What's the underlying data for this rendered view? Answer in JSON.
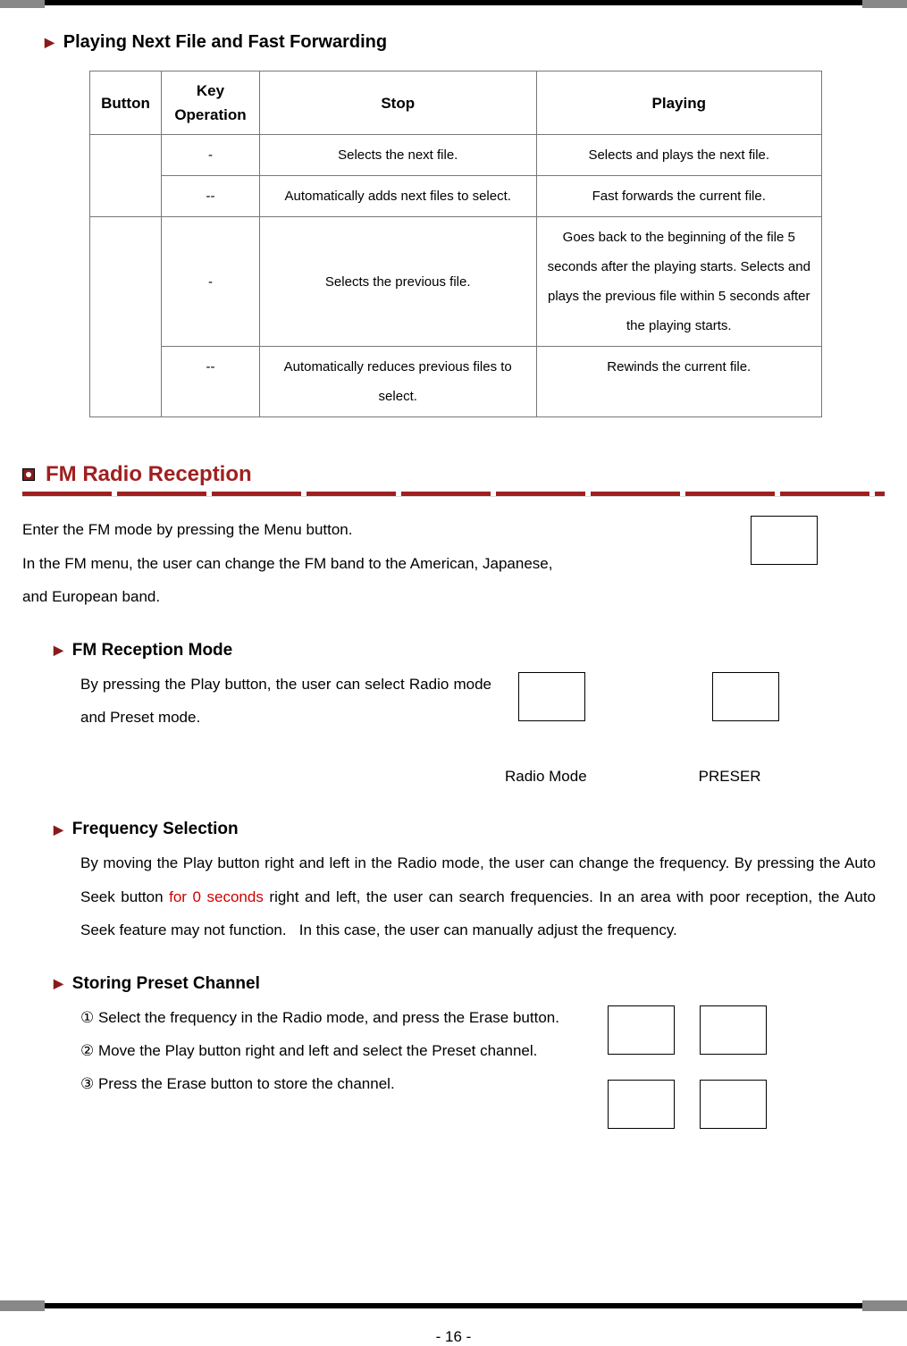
{
  "headings": {
    "playing_next": "Playing Next File and Fast Forwarding",
    "fm_radio": "FM Radio Reception",
    "fm_mode": "FM Reception Mode",
    "freq_sel": "Frequency Selection",
    "preset": "Storing Preset Channel"
  },
  "table": {
    "headers": {
      "button": "Button",
      "key_op": "Key Operation",
      "stop": "Stop",
      "playing": "Playing"
    },
    "rows": [
      {
        "key_op": "-",
        "stop": "Selects the next file.",
        "playing": "Selects and plays the next file."
      },
      {
        "key_op": "--",
        "stop": "Automatically adds next files to select.",
        "playing": "Fast forwards the current file."
      },
      {
        "key_op": "-",
        "stop": "Selects the previous file.",
        "playing": "Goes back to the beginning of the file 5 seconds after the playing starts. Selects and plays the previous file within 5 seconds after the playing starts."
      },
      {
        "key_op": "--",
        "stop": "Automatically reduces previous files to select.",
        "playing": "Rewinds the current file."
      }
    ]
  },
  "fm_intro": "Enter the FM mode by pressing the Menu button. In the FM menu, the user can change the FM band to the American, Japanese, and European band.",
  "fm_intro_line1": "Enter the FM mode by pressing the Menu button.",
  "fm_intro_line2": "In the FM menu, the user can change the FM band to the American, Japanese,",
  "fm_intro_line3": "and European band.",
  "fm_mode_text": "By pressing the Play button, the user can select Radio mode and Preset mode.",
  "mode_labels": {
    "radio": "Radio Mode",
    "preset": "PRESER"
  },
  "freq_text_pre": "By moving the Play button right and left in the Radio mode, the user can change the frequency. By pressing the Auto Seek button ",
  "freq_text_red": "for 0 seconds",
  "freq_text_post": " right and left, the user can search frequencies. In an area with poor reception, the Auto Seek feature may not function.   In this case, the user can manually adjust the frequency.",
  "preset_steps": {
    "s1": "① Select the frequency in the Radio mode, and press the Erase button.",
    "s2": "② Move the Play button right and left and select the Preset channel.",
    "s3": "③ Press the Erase button to store the channel."
  },
  "page_number": "- 16 -"
}
